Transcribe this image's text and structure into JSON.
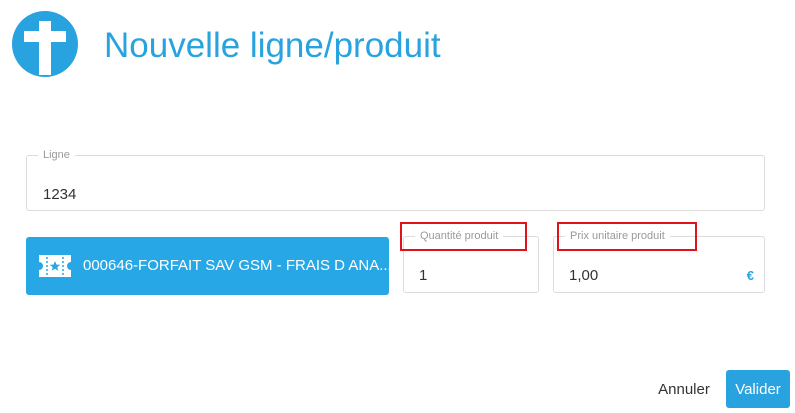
{
  "header": {
    "logo_icon": "t-logo-icon",
    "title": "Nouvelle ligne/produit",
    "accent_color": "#29a3df"
  },
  "form": {
    "ligne": {
      "label": "Ligne",
      "value": "1234"
    },
    "product": {
      "icon": "ticket-star-icon",
      "label": "000646-FORFAIT SAV GSM - FRAIS D ANA..."
    },
    "quantity": {
      "label": "Quantité produit",
      "value": "1"
    },
    "unit_price": {
      "label": "Prix unitaire produit",
      "value": "1,00",
      "currency": "€"
    }
  },
  "actions": {
    "cancel_label": "Annuler",
    "submit_label": "Valider"
  },
  "annotations": {
    "highlight_color": "#e0121c",
    "highlighted": [
      "Quantité produit",
      "Prix unitaire produit"
    ]
  }
}
